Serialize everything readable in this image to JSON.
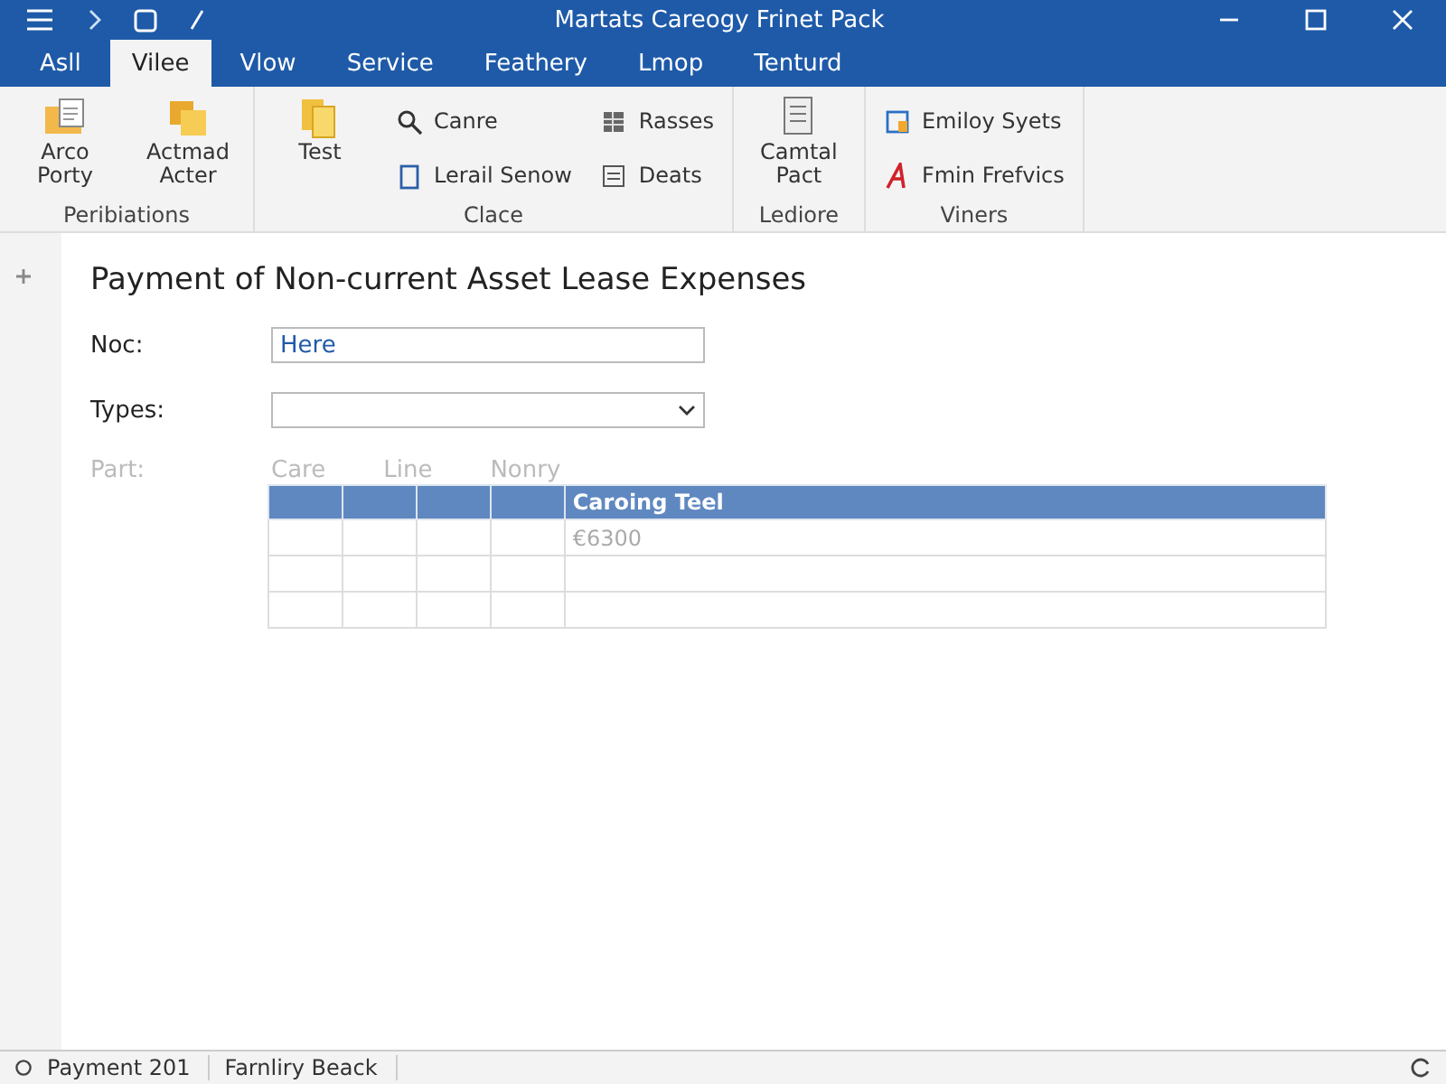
{
  "window": {
    "title": "Martats Careogy Frinet Pack"
  },
  "tabs": [
    {
      "label": "Asll",
      "selected": false
    },
    {
      "label": "Vilee",
      "selected": true
    },
    {
      "label": "Vlow",
      "selected": false
    },
    {
      "label": "Service",
      "selected": false
    },
    {
      "label": "Feathery",
      "selected": false
    },
    {
      "label": "Lmop",
      "selected": false
    },
    {
      "label": "Tenturd",
      "selected": false
    }
  ],
  "ribbon": {
    "groups": [
      {
        "label": "Peribiations",
        "items": [
          {
            "kind": "large",
            "label": "Arco Porty"
          },
          {
            "kind": "large",
            "label": "Actmad Acter"
          }
        ]
      },
      {
        "label": "Clace",
        "items": [
          {
            "kind": "large",
            "label": "Test"
          },
          {
            "kind": "small",
            "label": "Canre"
          },
          {
            "kind": "small",
            "label": "Lerail Senow"
          },
          {
            "kind": "small",
            "label": "Rasses"
          },
          {
            "kind": "small",
            "label": "Deats"
          }
        ]
      },
      {
        "label": "Lediore",
        "items": [
          {
            "kind": "large",
            "label": "Camtal Pact"
          }
        ]
      },
      {
        "label": "Viners",
        "items": [
          {
            "kind": "small",
            "label": "Emiloy Syets"
          },
          {
            "kind": "small",
            "label": "Fmin Frefvics"
          }
        ]
      }
    ]
  },
  "form": {
    "title": "Payment of Non-current Asset Lease Expenses",
    "fields": [
      {
        "kind": "text",
        "label": "Noc:",
        "value": "Here"
      },
      {
        "kind": "dropdown",
        "label": "Types:"
      }
    ],
    "part": {
      "label": "Part:",
      "headings": [
        "Care",
        "Line",
        "Nonry"
      ]
    },
    "table": {
      "columns": [
        {},
        {},
        {},
        {},
        {
          "label": "Caroing Teel"
        }
      ],
      "rows": [
        {
          "cells": [
            {},
            {},
            {},
            {},
            {
              "text": "€6300"
            }
          ]
        },
        {
          "cells": [
            {},
            {},
            {},
            {},
            {}
          ]
        },
        {
          "cells": [
            {},
            {},
            {},
            {},
            {}
          ]
        }
      ]
    }
  },
  "status_bar": {
    "items": [
      "Payment 201",
      "Farnliry Beack"
    ]
  }
}
